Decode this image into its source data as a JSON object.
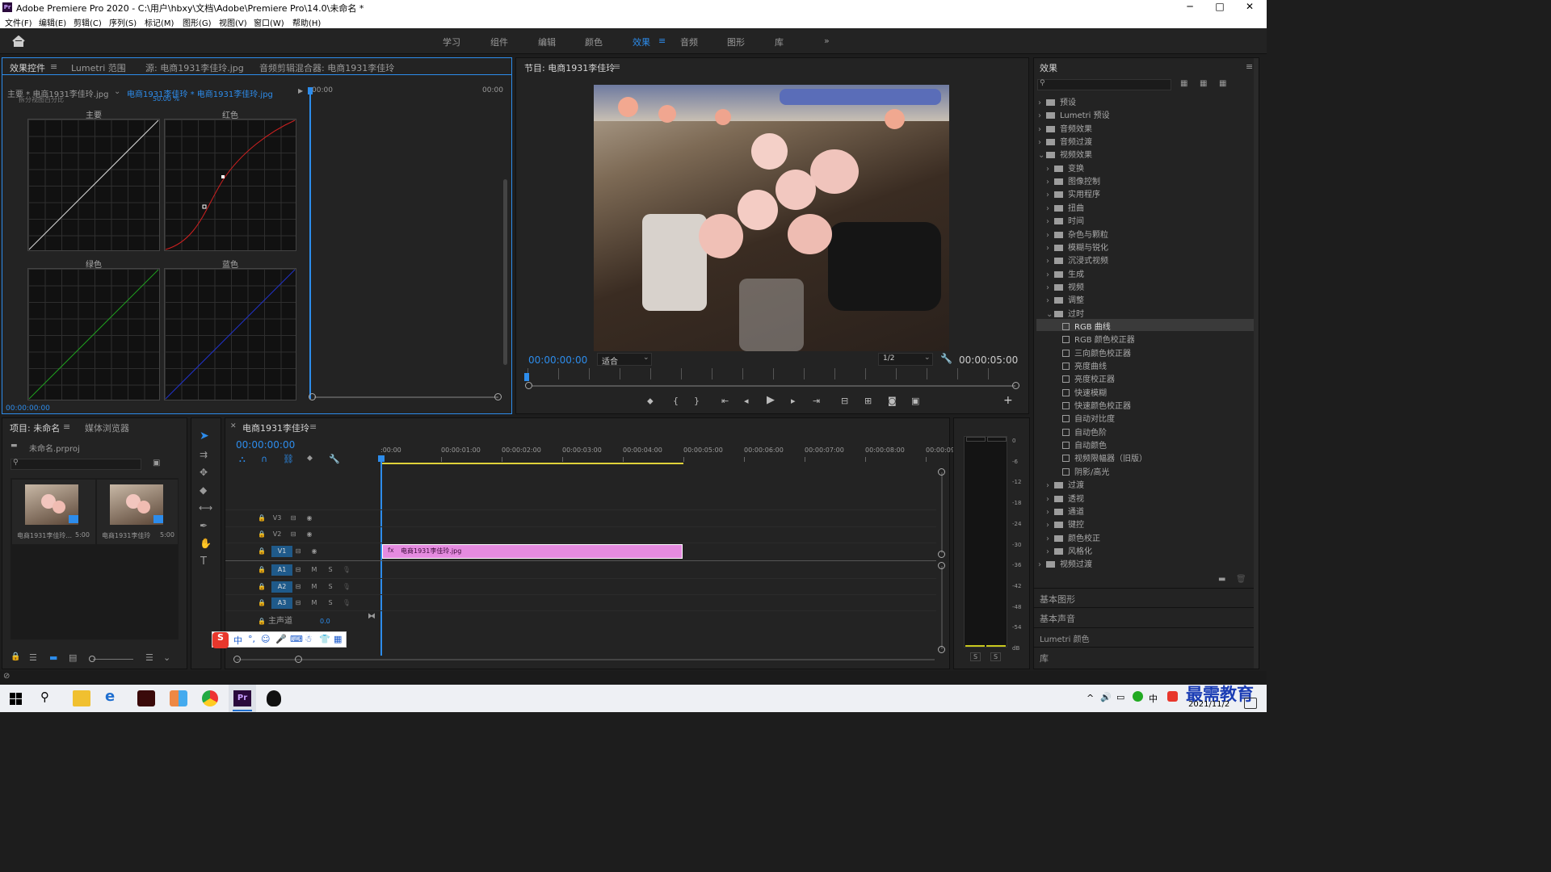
{
  "window": {
    "title": "Adobe Premiere Pro 2020 - C:\\用户\\hbxy\\文档\\Adobe\\Premiere Pro\\14.0\\未命名 *",
    "logo": "Pr",
    "min": "─",
    "max": "□",
    "close": "✕"
  },
  "menu": [
    "文件(F)",
    "编辑(E)",
    "剪辑(C)",
    "序列(S)",
    "标记(M)",
    "图形(G)",
    "视图(V)",
    "窗口(W)",
    "帮助(H)"
  ],
  "workspaces": [
    "学习",
    "组件",
    "编辑",
    "颜色",
    "效果",
    "音频",
    "图形",
    "库"
  ],
  "workspace_active": "效果",
  "workspace_more": "»",
  "effect_controls": {
    "tabs": [
      "效果控件",
      "Lumetri 范围",
      "源: 电商1931李佳玲.jpg",
      "音频剪辑混合器: 电商1931李佳玲"
    ],
    "master": "主要 * 电商1931李佳玲.jpg",
    "clip": "电商1931李佳玲 * 电商1931李佳玲.jpg",
    "time_start": "00:00",
    "time_end": "00:00",
    "partial": "拆分视图百分比",
    "partial_val": "50.00 %",
    "curves": [
      "主要",
      "红色",
      "绿色",
      "蓝色"
    ],
    "timecode": "00:00:00:00"
  },
  "program": {
    "title": "节目: 电商1931李佳玲",
    "timecode": "00:00:00:00",
    "fit": "适合",
    "res": "1/2",
    "duration": "00:00:05:00"
  },
  "effects_panel": {
    "title": "效果",
    "search_placeholder": "",
    "items": [
      {
        "t": "预设",
        "lvl": 0,
        "type": "folder",
        "open": false
      },
      {
        "t": "Lumetri 预设",
        "lvl": 0,
        "type": "folder",
        "open": false
      },
      {
        "t": "音频效果",
        "lvl": 0,
        "type": "folder",
        "open": false
      },
      {
        "t": "音频过渡",
        "lvl": 0,
        "type": "folder",
        "open": false
      },
      {
        "t": "视频效果",
        "lvl": 0,
        "type": "folder",
        "open": true
      },
      {
        "t": "变换",
        "lvl": 1,
        "type": "folder",
        "open": false
      },
      {
        "t": "图像控制",
        "lvl": 1,
        "type": "folder",
        "open": false
      },
      {
        "t": "实用程序",
        "lvl": 1,
        "type": "folder",
        "open": false
      },
      {
        "t": "扭曲",
        "lvl": 1,
        "type": "folder",
        "open": false
      },
      {
        "t": "时间",
        "lvl": 1,
        "type": "folder",
        "open": false
      },
      {
        "t": "杂色与颗粒",
        "lvl": 1,
        "type": "folder",
        "open": false
      },
      {
        "t": "模糊与锐化",
        "lvl": 1,
        "type": "folder",
        "open": false
      },
      {
        "t": "沉浸式视频",
        "lvl": 1,
        "type": "folder",
        "open": false
      },
      {
        "t": "生成",
        "lvl": 1,
        "type": "folder",
        "open": false
      },
      {
        "t": "视频",
        "lvl": 1,
        "type": "folder",
        "open": false
      },
      {
        "t": "调整",
        "lvl": 1,
        "type": "folder",
        "open": false
      },
      {
        "t": "过时",
        "lvl": 1,
        "type": "folder",
        "open": true
      },
      {
        "t": "RGB 曲线",
        "lvl": 2,
        "type": "fx",
        "sel": true
      },
      {
        "t": "RGB 颜色校正器",
        "lvl": 2,
        "type": "fx"
      },
      {
        "t": "三向颜色校正器",
        "lvl": 2,
        "type": "fx"
      },
      {
        "t": "亮度曲线",
        "lvl": 2,
        "type": "fx"
      },
      {
        "t": "亮度校正器",
        "lvl": 2,
        "type": "fx"
      },
      {
        "t": "快速模糊",
        "lvl": 2,
        "type": "fx"
      },
      {
        "t": "快速颜色校正器",
        "lvl": 2,
        "type": "fx"
      },
      {
        "t": "自动对比度",
        "lvl": 2,
        "type": "fx"
      },
      {
        "t": "自动色阶",
        "lvl": 2,
        "type": "fx"
      },
      {
        "t": "自动颜色",
        "lvl": 2,
        "type": "fx"
      },
      {
        "t": "视频限幅器（旧版）",
        "lvl": 2,
        "type": "fx"
      },
      {
        "t": "阴影/高光",
        "lvl": 2,
        "type": "fx"
      },
      {
        "t": "过渡",
        "lvl": 1,
        "type": "folder",
        "open": false
      },
      {
        "t": "透视",
        "lvl": 1,
        "type": "folder",
        "open": false
      },
      {
        "t": "通道",
        "lvl": 1,
        "type": "folder",
        "open": false
      },
      {
        "t": "键控",
        "lvl": 1,
        "type": "folder",
        "open": false
      },
      {
        "t": "颜色校正",
        "lvl": 1,
        "type": "folder",
        "open": false
      },
      {
        "t": "风格化",
        "lvl": 1,
        "type": "folder",
        "open": false
      },
      {
        "t": "视频过渡",
        "lvl": 0,
        "type": "folder",
        "open": false
      }
    ],
    "sections": [
      "基本图形",
      "基本声音",
      "Lumetri 颜色",
      "库"
    ]
  },
  "project": {
    "tabs": [
      "项目: 未命名",
      "媒体浏览器"
    ],
    "file": "未命名.prproj",
    "items": [
      {
        "name": "电商1931李佳玲...",
        "dur": "5:00"
      },
      {
        "name": "电商1931李佳玲",
        "dur": "5:00"
      }
    ]
  },
  "timeline": {
    "title": "电商1931李佳玲",
    "timecode": "00:00:00:00",
    "ruler": [
      ":00:00",
      "00:00:01:00",
      "00:00:02:00",
      "00:00:03:00",
      "00:00:04:00",
      "00:00:05:00",
      "00:00:06:00",
      "00:00:07:00",
      "00:00:08:00",
      "00:00:09:"
    ],
    "video_tracks": [
      "V3",
      "V2",
      "V1"
    ],
    "audio_tracks": [
      "A1",
      "A2",
      "A3"
    ],
    "master": "主声道",
    "master_val": "0.0",
    "clip": "电商1931李佳玲.jpg",
    "m": "M",
    "s": "S"
  },
  "meter": {
    "ticks": [
      "0",
      "-6",
      "-12",
      "-18",
      "-24",
      "-30",
      "-36",
      "-42",
      "-48",
      "-54",
      "dB"
    ],
    "s": "S"
  },
  "taskbar": {
    "date": "2021/11/2",
    "watermark": "最需教育"
  }
}
